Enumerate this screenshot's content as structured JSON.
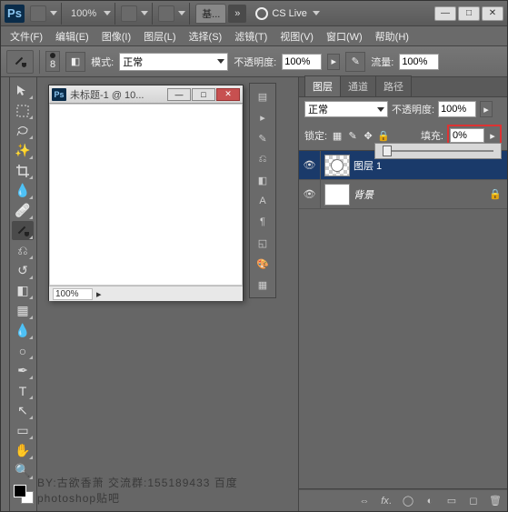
{
  "title": {
    "zoom": "100%",
    "tab": "基...",
    "cslive": "CS Live"
  },
  "menus": [
    "文件(F)",
    "编辑(E)",
    "图像(I)",
    "图层(L)",
    "选择(S)",
    "滤镜(T)",
    "视图(V)",
    "窗口(W)",
    "帮助(H)"
  ],
  "opt": {
    "brushSize": "8",
    "modeLabel": "模式:",
    "mode": "正常",
    "opacityLabel": "不透明度:",
    "opacity": "100%",
    "flowLabel": "流量:",
    "flow": "100%"
  },
  "doc": {
    "title": "未标题-1 @ 10...",
    "zoom": "100%"
  },
  "panel": {
    "tabs": [
      "图层",
      "通道",
      "路径"
    ],
    "blend": "正常",
    "opacityLabel": "不透明度:",
    "opacity": "100%",
    "lockLabel": "锁定:",
    "fillLabel": "填充:",
    "fill": "0%",
    "layers": [
      {
        "name": "图层 1",
        "selected": true,
        "checker": true,
        "locked": false
      },
      {
        "name": "背景",
        "selected": false,
        "checker": false,
        "locked": true
      }
    ]
  },
  "credit": "BY:古欲香萧   交流群:155189433   百度photoshop贴吧"
}
